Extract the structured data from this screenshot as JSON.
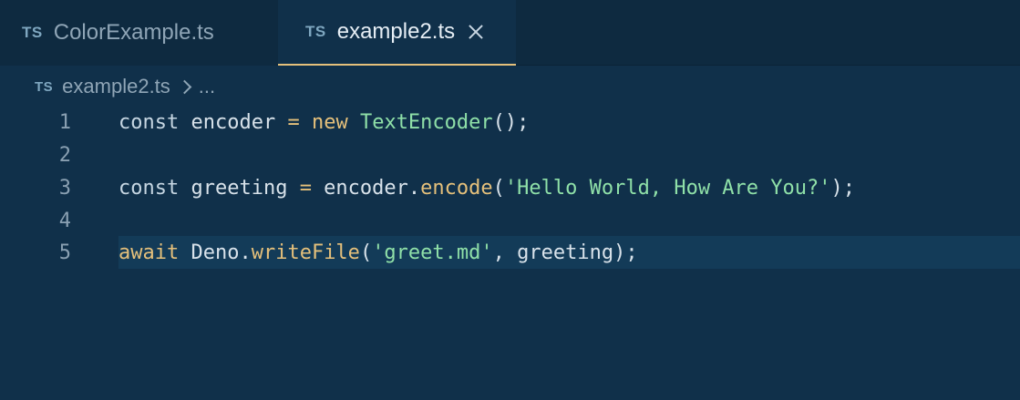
{
  "tabs": [
    {
      "badge": "TS",
      "label": "ColorExample.ts",
      "active": false
    },
    {
      "badge": "TS",
      "label": "example2.ts",
      "active": true
    }
  ],
  "breadcrumb": {
    "badge": "TS",
    "file": "example2.ts",
    "ellipsis": "..."
  },
  "editor": {
    "current_line": 5,
    "lines": [
      {
        "number": "1",
        "tokens": [
          {
            "t": "const",
            "k": "kw"
          },
          {
            "t": " encoder ",
            "k": "id"
          },
          {
            "t": "=",
            "k": "op"
          },
          {
            "t": " ",
            "k": "id"
          },
          {
            "t": "new",
            "k": "new"
          },
          {
            "t": " ",
            "k": "id"
          },
          {
            "t": "TextEncoder",
            "k": "type"
          },
          {
            "t": "();",
            "k": "punct"
          }
        ]
      },
      {
        "number": "2",
        "tokens": []
      },
      {
        "number": "3",
        "tokens": [
          {
            "t": "const",
            "k": "kw"
          },
          {
            "t": " greeting ",
            "k": "id"
          },
          {
            "t": "=",
            "k": "op"
          },
          {
            "t": " encoder.",
            "k": "id"
          },
          {
            "t": "encode",
            "k": "fn"
          },
          {
            "t": "(",
            "k": "punct"
          },
          {
            "t": "'Hello World, How Are You?'",
            "k": "str"
          },
          {
            "t": ");",
            "k": "punct"
          }
        ]
      },
      {
        "number": "4",
        "tokens": []
      },
      {
        "number": "5",
        "tokens": [
          {
            "t": "await",
            "k": "await"
          },
          {
            "t": " Deno.",
            "k": "id"
          },
          {
            "t": "writeFile",
            "k": "fn"
          },
          {
            "t": "(",
            "k": "punct"
          },
          {
            "t": "'greet.md'",
            "k": "str"
          },
          {
            "t": ", greeting);",
            "k": "punct"
          }
        ]
      }
    ]
  },
  "colors": {
    "background": "#10304a",
    "tab_active_underline": "#e5c07b",
    "string": "#8fe0a8",
    "keyword_accent": "#e5c07b"
  },
  "icons": {
    "tab_file_icon": "typescript-badge",
    "tab_close": "close-icon",
    "breadcrumb_separator": "chevron-right-icon"
  }
}
